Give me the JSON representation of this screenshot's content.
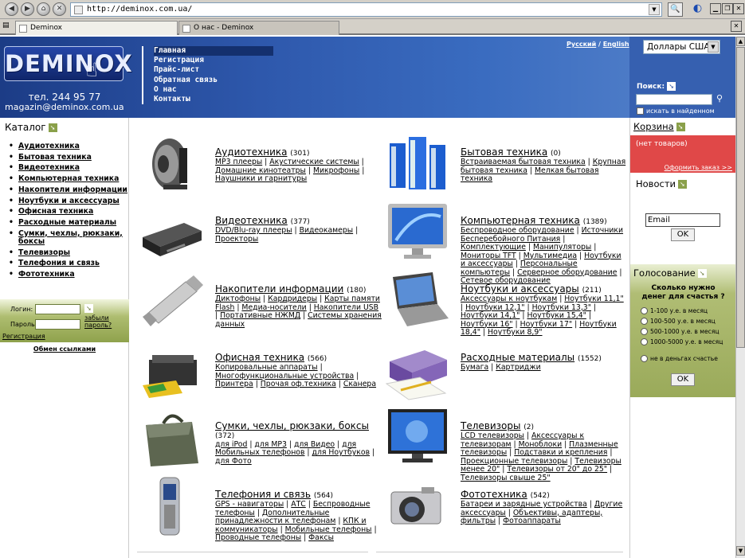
{
  "browser": {
    "url": "http://deminox.com.ua/",
    "tabs": [
      {
        "label": "Deminox"
      },
      {
        "label": "О нас - Deminox"
      }
    ]
  },
  "header": {
    "logo_text": "DEMINOX",
    "phone": "тел. 244 95 77",
    "email": "magazin@deminox.com.ua",
    "nav": [
      "Главная",
      "Регистрация",
      "Прайс-лист",
      "Обратная связь",
      "О нас",
      "Контакты"
    ],
    "lang_ru": "Русский",
    "lang_sep": "/",
    "lang_en": "English"
  },
  "search": {
    "currency": "Доллары США",
    "label": "Поиск:",
    "in_found": "искать в найденном"
  },
  "catalog": {
    "title": "Каталог",
    "items": [
      "Аудиотехника",
      "Бытовая техника",
      "Видеотехника",
      "Компьютерная техника",
      "Накопители информации",
      "Ноутбуки и аксессуары",
      "Офисная техника",
      "Расходные материалы",
      "Сумки, чехлы, рюкзаки, боксы",
      "Телевизоры",
      "Телефония и связь",
      "Фототехника"
    ]
  },
  "login": {
    "login_label": "Логин:",
    "pass_label": "Пароль:",
    "forgot": "забыли пароль?",
    "register": "Регистрация",
    "exchange": "Обмен ссылками"
  },
  "categories": [
    {
      "title": "Аудиотехника",
      "count": "(301)",
      "links": [
        "MP3 плееры",
        "Акустические системы",
        "Домашние кинотеатры",
        "Микрофоны",
        "Наушники и гарнитуры"
      ]
    },
    {
      "title": "Бытовая техника",
      "count": "(0)",
      "links": [
        "Встраиваемая бытовая техника",
        "Крупная бытовая техника",
        "Мелкая бытовая техника"
      ]
    },
    {
      "title": "Видеотехника",
      "count": "(377)",
      "links": [
        "DVD/Blu-ray плееры",
        "Видеокамеры",
        "Проекторы"
      ]
    },
    {
      "title": "Компьютерная техника",
      "count": "(1389)",
      "links": [
        "Беспроводное оборудование",
        "Источники Бесперебойного Питания",
        "Комплектующие",
        "Манипуляторы",
        "Мониторы TFT",
        "Мультимедиа",
        "Ноутбуки и аксессуары",
        "Персональные компьютеры",
        "Серверное оборудование",
        "Сетевое оборудование"
      ]
    },
    {
      "title": "Накопители информации",
      "count": "(180)",
      "links": [
        "Диктофоны",
        "Кардридеры",
        "Карты памяти Flash",
        "Медиа-носители",
        "Накопители USB",
        "Портативные НЖМД",
        "Системы хранения данных"
      ]
    },
    {
      "title": "Ноутбуки и аксессуары",
      "count": "(211)",
      "links": [
        "Аксессуары к ноутбукам",
        "Ноутбуки 11,1\"",
        "Ноутбуки 12,1\"",
        "Ноутбуки 13,3\"",
        "Ноутбуки 14,1\"",
        "Ноутбуки 15,4\"",
        "Ноутбуки 16\"",
        "Ноутбуки 17\"",
        "Ноутбуки 18,4\"",
        "Ноутбуки 8,9\""
      ]
    },
    {
      "title": "Офисная техника",
      "count": "(566)",
      "links": [
        "Копировальные аппараты",
        "Многофункциональные устройства",
        "Принтера",
        "Прочая оф.техника",
        "Сканера"
      ]
    },
    {
      "title": "Расходные материалы",
      "count": "(1552)",
      "links": [
        "Бумага",
        "Картриджи"
      ]
    },
    {
      "title": "Сумки, чехлы, рюкзаки, боксы",
      "count": "(372)",
      "links": [
        "для iPod",
        "для MP3",
        "для Видео",
        "для Мобильных телефонов",
        "для Ноутбуков",
        "для Фото"
      ]
    },
    {
      "title": "Телевизоры",
      "count": "(2)",
      "links": [
        "LCD телевизоры",
        "Аксессуары к телевизорам",
        "Моноблоки",
        "Плазменные телевизоры",
        "Подставки и крепления",
        "Проекционные телевизоры",
        "Телевизоры менее 20\"",
        "Телевизоры от 20\" до 25\"",
        "Телевизоры свыше 25\""
      ]
    },
    {
      "title": "Телефония и связь",
      "count": "(564)",
      "links": [
        "GPS - навигаторы",
        "АТС",
        "Беспроводные телефоны",
        "Дополнительные принадлежности к телефонам",
        "КПК и коммуникаторы",
        "Мобильные телефоны",
        "Проводные телефоны",
        "Факсы"
      ]
    },
    {
      "title": "Фототехника",
      "count": "(542)",
      "links": [
        "Батареи и зарядные устройства",
        "Другие аксессуары",
        "Объективы, адаптеры, фильтры",
        "Фотоаппараты"
      ]
    }
  ],
  "cart": {
    "title": "Корзина",
    "empty": "(нет товаров)",
    "order": "Оформить заказ >>"
  },
  "news": {
    "title": "Новости",
    "email_placeholder": "Email",
    "ok": "OK"
  },
  "poll": {
    "title": "Голосование",
    "question": "Сколько нужно денег для счастья ?",
    "options": [
      "1-100 у.е. в месяц",
      "100-500 у.е. в месяц",
      "500-1000 у.е. в месяц",
      "1000-5000 у.е. в месяц",
      "не в деньгах счастье"
    ],
    "ok": "OK"
  },
  "colors": {
    "header_blue": "#2e58ac",
    "cart_red": "#e04848",
    "olive": "#9aaa5a"
  }
}
